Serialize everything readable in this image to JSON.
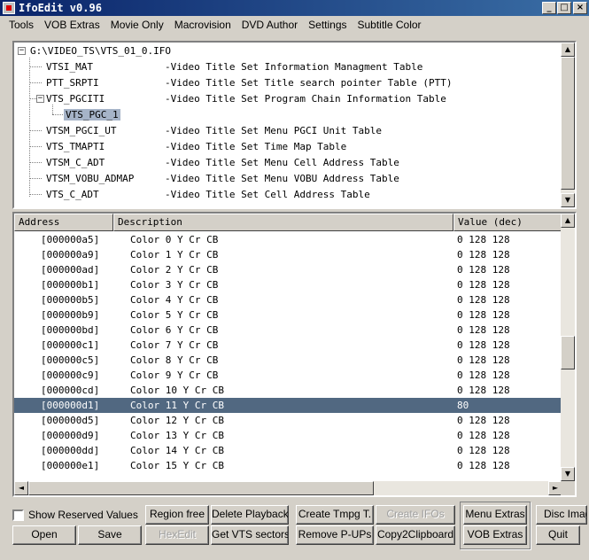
{
  "window": {
    "title": "IfoEdit v0.96",
    "minimize": "_",
    "maximize": "□",
    "close": "×"
  },
  "menu": [
    "Tools",
    "VOB Extras",
    "Movie Only",
    "Macrovision",
    "DVD Author",
    "Settings",
    "Subtitle Color"
  ],
  "tree": {
    "root": "G:\\VIDEO_TS\\VTS_01_0.IFO",
    "nodes": [
      {
        "name": "VTSI_MAT",
        "desc": "-Video Title Set Information Managment Table"
      },
      {
        "name": "PTT_SRPTI",
        "desc": "-Video Title Set Title search pointer Table (PTT)"
      },
      {
        "name": "VTS_PGCITI",
        "desc": "-Video Title Set Program Chain Information Table"
      },
      {
        "name": "VTS_PGC_1",
        "desc": ""
      },
      {
        "name": "VTSM_PGCI_UT",
        "desc": "-Video Title Set Menu PGCI Unit Table"
      },
      {
        "name": "VTS_TMAPTI",
        "desc": "-Video Title Set Time Map Table"
      },
      {
        "name": "VTSM_C_ADT",
        "desc": "-Video Title Set Menu Cell Address Table"
      },
      {
        "name": "VTSM_VOBU_ADMAP",
        "desc": "-Video Title Set Menu VOBU Address Table"
      },
      {
        "name": "VTS_C_ADT",
        "desc": "-Video Title Set Cell Address Table"
      }
    ]
  },
  "list": {
    "headers": {
      "address": "Address",
      "description": "Description",
      "value": "Value (dec)"
    },
    "rows": [
      {
        "address": "[000000a5]",
        "description": "Color 0 Y Cr CB",
        "value": "0 128 128"
      },
      {
        "address": "[000000a9]",
        "description": "Color 1 Y Cr CB",
        "value": "0 128 128"
      },
      {
        "address": "[000000ad]",
        "description": "Color 2 Y Cr CB",
        "value": "0 128 128"
      },
      {
        "address": "[000000b1]",
        "description": "Color 3 Y Cr CB",
        "value": "0 128 128"
      },
      {
        "address": "[000000b5]",
        "description": "Color 4 Y Cr CB",
        "value": "0 128 128"
      },
      {
        "address": "[000000b9]",
        "description": "Color 5 Y Cr CB",
        "value": "0 128 128"
      },
      {
        "address": "[000000bd]",
        "description": "Color 6 Y Cr CB",
        "value": "0 128 128"
      },
      {
        "address": "[000000c1]",
        "description": "Color 7 Y Cr CB",
        "value": "0 128 128"
      },
      {
        "address": "[000000c5]",
        "description": "Color 8 Y Cr CB",
        "value": "0 128 128"
      },
      {
        "address": "[000000c9]",
        "description": "Color 9 Y Cr CB",
        "value": "0 128 128"
      },
      {
        "address": "[000000cd]",
        "description": "Color 10 Y Cr CB",
        "value": "0 128 128"
      },
      {
        "address": "[000000d1]",
        "description": "Color 11 Y Cr CB",
        "value": "80"
      },
      {
        "address": "[000000d5]",
        "description": "Color 12 Y Cr CB",
        "value": "0 128 128"
      },
      {
        "address": "[000000d9]",
        "description": "Color 13 Y Cr CB",
        "value": "0 128 128"
      },
      {
        "address": "[000000dd]",
        "description": "Color 14 Y Cr CB",
        "value": "0 128 128"
      },
      {
        "address": "[000000e1]",
        "description": "Color 15 Y Cr CB",
        "value": "0 128 128"
      }
    ]
  },
  "controls": {
    "show_reserved": "Show Reserved Values",
    "open": "Open",
    "save": "Save",
    "region_free": "Region free",
    "hexedit": "HexEdit",
    "delete_playback": "Delete Playback",
    "get_vts_sectors": "Get VTS sectors",
    "create_tmpg": "Create Tmpg T.",
    "remove_pups": "Remove P-UPs",
    "create_ifos": "Create IFOs",
    "copy2clipboard": "Copy2Clipboard",
    "menu_extras": "Menu Extras",
    "vob_extras": "VOB Extras",
    "disc_image": "Disc Imag",
    "quit": "Quit"
  },
  "scroll_icons": {
    "up": "▲",
    "down": "▼",
    "left": "◄",
    "right": "►"
  },
  "colors": {
    "titlebar": "#0a246a",
    "selected_row": "#516881",
    "selected_node": "#a6b4c8",
    "face": "#d4d0c8"
  }
}
